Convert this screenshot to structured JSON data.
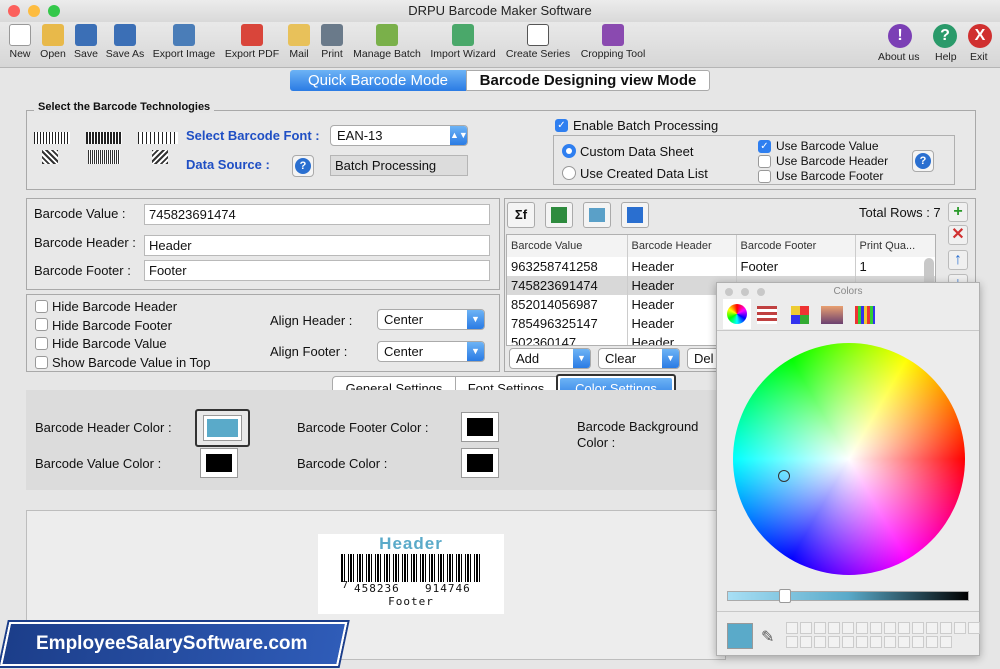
{
  "window": {
    "title": "DRPU Barcode Maker Software"
  },
  "toolbar": {
    "items": [
      {
        "label": "New",
        "icon": "new-doc-icon",
        "color": "#4a90d9"
      },
      {
        "label": "Open",
        "icon": "open-folder-icon",
        "color": "#e8b94a"
      },
      {
        "label": "Save",
        "icon": "save-icon",
        "color": "#3b6fb6"
      },
      {
        "label": "Save As",
        "icon": "save-as-icon",
        "color": "#3b6fb6"
      },
      {
        "label": "Export Image",
        "icon": "export-image-icon",
        "color": "#4a7db8"
      },
      {
        "label": "Export PDF",
        "icon": "export-pdf-icon",
        "color": "#d9453a"
      },
      {
        "label": "Mail",
        "icon": "mail-icon",
        "color": "#e8c15a"
      },
      {
        "label": "Print",
        "icon": "print-icon",
        "color": "#6a7a8a"
      },
      {
        "label": "Manage Batch",
        "icon": "manage-batch-icon",
        "color": "#7ab04a"
      },
      {
        "label": "Import Wizard",
        "icon": "import-wizard-icon",
        "color": "#4aa86a"
      },
      {
        "label": "Create Series",
        "icon": "create-series-icon",
        "color": "#555555"
      },
      {
        "label": "Cropping Tool",
        "icon": "crop-icon",
        "color": "#8a4ab0"
      }
    ],
    "right": [
      {
        "label": "About us",
        "glyph": "!",
        "color": "#7b3fb5"
      },
      {
        "label": "Help",
        "glyph": "?",
        "color": "#2a9a6a"
      },
      {
        "label": "Exit",
        "glyph": "X",
        "color": "#d03030"
      }
    ]
  },
  "mode_tabs": {
    "quick": "Quick Barcode Mode",
    "designing": "Barcode Designing view Mode"
  },
  "technologies": {
    "title": "Select the Barcode Technologies",
    "font_label": "Select Barcode Font :",
    "font_value": "EAN-13",
    "source_label": "Data Source :",
    "source_value": "Batch Processing"
  },
  "batch": {
    "enable_label": "Enable Batch Processing",
    "custom_sheet": "Custom Data Sheet",
    "created_list": "Use Created Data List",
    "use_value": "Use Barcode Value",
    "use_header": "Use Barcode Header",
    "use_footer": "Use Barcode Footer"
  },
  "values": {
    "value_label": "Barcode Value :",
    "value": "745823691474",
    "header_label": "Barcode Header :",
    "header": "Header",
    "footer_label": "Barcode Footer :",
    "footer": "Footer"
  },
  "options": {
    "hide_header": "Hide Barcode Header",
    "hide_footer": "Hide Barcode Footer",
    "hide_value": "Hide Barcode Value",
    "show_top": "Show Barcode Value in Top",
    "align_header_label": "Align Header :",
    "align_header": "Center",
    "align_footer_label": "Align Footer :",
    "align_footer": "Center"
  },
  "table": {
    "total_rows": "Total Rows : 7",
    "columns": [
      "Barcode Value",
      "Barcode Header",
      "Barcode Footer",
      "Print Qua..."
    ],
    "rows": [
      [
        "963258741258",
        "Header",
        "Footer",
        "1"
      ],
      [
        "745823691474",
        "Header",
        "",
        ""
      ],
      [
        "852014056987",
        "Header",
        "",
        ""
      ],
      [
        "785496325147",
        "Header",
        "",
        ""
      ],
      [
        "502360147...",
        "Header",
        "",
        ""
      ]
    ],
    "add": "Add",
    "clear": "Clear",
    "delete": "Del"
  },
  "settings_tabs": {
    "general": "General Settings",
    "font": "Font Settings",
    "color": "Color Settings"
  },
  "colors_section": {
    "header_color_label": "Barcode Header Color :",
    "header_color": "#5aaac9",
    "footer_color_label": "Barcode Footer Color :",
    "footer_color": "#000000",
    "value_color_label": "Barcode Value Color :",
    "value_color": "#000000",
    "barcode_color_label": "Barcode Color :",
    "barcode_color": "#000000",
    "background_label": "Barcode Background Color :"
  },
  "preview": {
    "header": "Header",
    "digits_left": "7",
    "digits_mid": "458236",
    "digits_right": "914746",
    "footer": "Footer",
    "header_color": "#5aaac9"
  },
  "banner": {
    "text": "EmployeeSalarySoftware.com"
  },
  "color_picker": {
    "title": "Colors",
    "selected": "#5aaac9"
  }
}
